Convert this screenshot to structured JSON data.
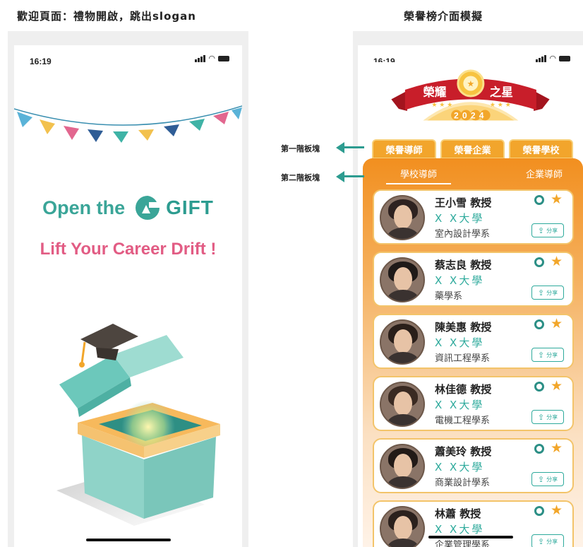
{
  "captions": {
    "left": "歡迎頁面：禮物開啟，跳出slogan",
    "right": "榮譽榜介面模擬"
  },
  "left_screen": {
    "time": "16:19",
    "open_the": "Open the",
    "gift": "GIFT",
    "slogan": "Lift Your Career Drift !",
    "bunting_colors": [
      "#5ab3d8",
      "#f2c14e",
      "#e2678f",
      "#2f5d96",
      "#3fb3a6",
      "#f2c14e",
      "#e2678f",
      "#5ab3d8"
    ]
  },
  "right_screen": {
    "time": "16:19",
    "banner": {
      "title_left": "榮耀",
      "title_right": "之星",
      "year": "2024"
    },
    "tier1_tabs": [
      "榮譽導師",
      "榮譽企業",
      "榮譽學校"
    ],
    "tier2_tabs": [
      "學校導師",
      "企業導師"
    ],
    "share_label": "分享",
    "cards": [
      {
        "name": "王小雪  教授",
        "school": "X X大學",
        "dept": "室內設計學系"
      },
      {
        "name": "蔡志良  教授",
        "school": "X X大學",
        "dept": "藥學系"
      },
      {
        "name": "陳美惠  教授",
        "school": "X X大學",
        "dept": "資訊工程學系"
      },
      {
        "name": "林佳德  教授",
        "school": "X X大學",
        "dept": "電機工程學系"
      },
      {
        "name": "蕭美玲  教授",
        "school": "X X大學",
        "dept": "商業設計學系"
      },
      {
        "name": "林蕭  教授",
        "school": "X X大學",
        "dept": "企業管理學系"
      }
    ]
  },
  "annotations": {
    "first_block": "第一階板塊",
    "second_block": "第二階板塊"
  },
  "colors": {
    "teal": "#2d9c90",
    "pink": "#e25c84",
    "orange": "#f28f1f",
    "gold": "#f2a62a",
    "ribbon_red": "#c81e2a"
  }
}
